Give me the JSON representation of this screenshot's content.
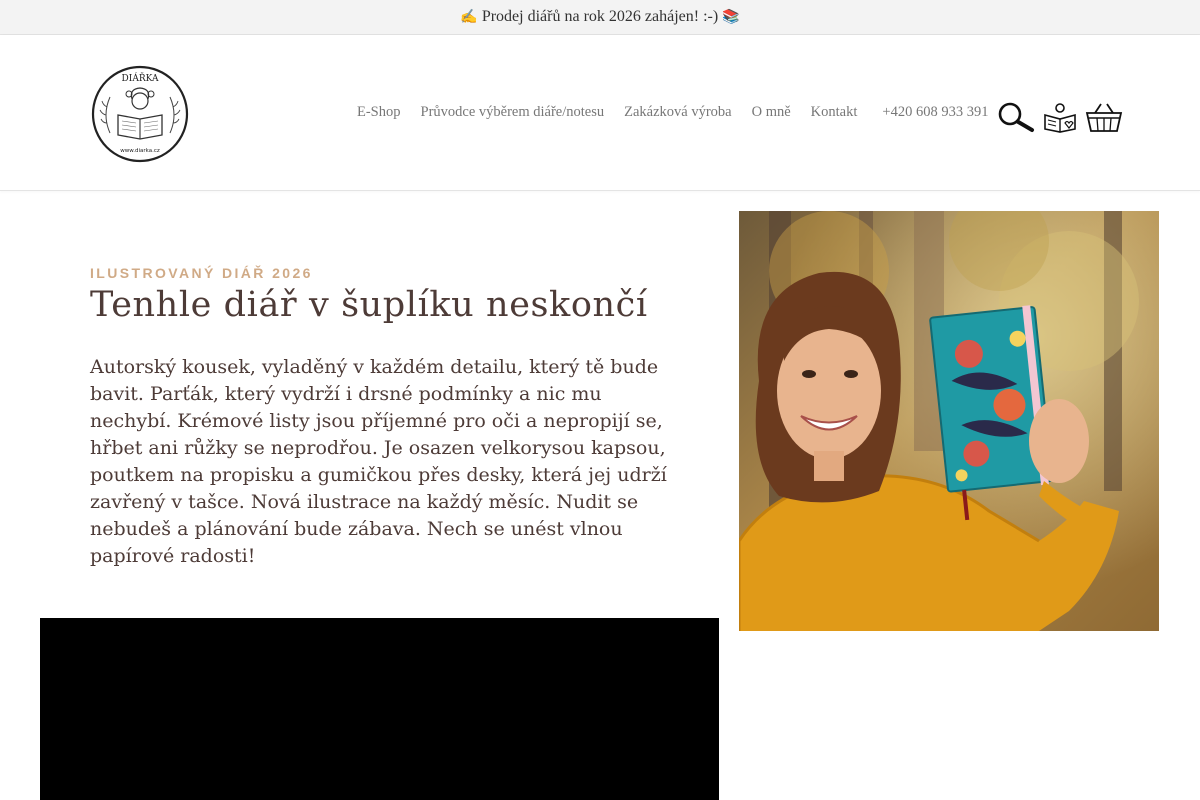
{
  "announcement": {
    "lead_emoji": "✍",
    "text": "Prodej diářů na rok 2026 zahájen! :-)",
    "trail_emoji": "📚"
  },
  "logo": {
    "wordmark": "DIÁŘKA",
    "url_text": "www.diarka.cz"
  },
  "nav": {
    "items": [
      "E-Shop",
      "Průvodce výběrem diáře/notesu",
      "Zakázková výroba",
      "O mně",
      "Kontakt"
    ],
    "phone": "+420 608 933 391"
  },
  "header_icons": [
    "search-icon",
    "book-heart-icon",
    "basket-icon"
  ],
  "hero": {
    "eyebrow": "ILUSTROVANÝ DIÁŘ 2026",
    "title": "Tenhle diář v šuplíku neskončí",
    "description": "Autorský kousek, vyladěný v každém detailu, který tě bude bavit. Parťák, který vydrží i drsné podmínky a nic mu nechybí. Krémové listy jsou příjemné pro oči a nepropijí se, hřbet ani růžky se neprodřou. Je osazen velkorysou kapsou, poutkem na propisku a gumičkou přes desky, která jej udrží zavřený v tašce. Nová ilustrace na každý měsíc. Nudit se nebudeš a plánování bude zábava. Nech se unést vlnou papírové radosti!"
  },
  "colors": {
    "eyebrow": "#d0aa86",
    "heading": "#4d3b37",
    "nav": "#777777",
    "topbar_bg": "#f3f3f3"
  }
}
